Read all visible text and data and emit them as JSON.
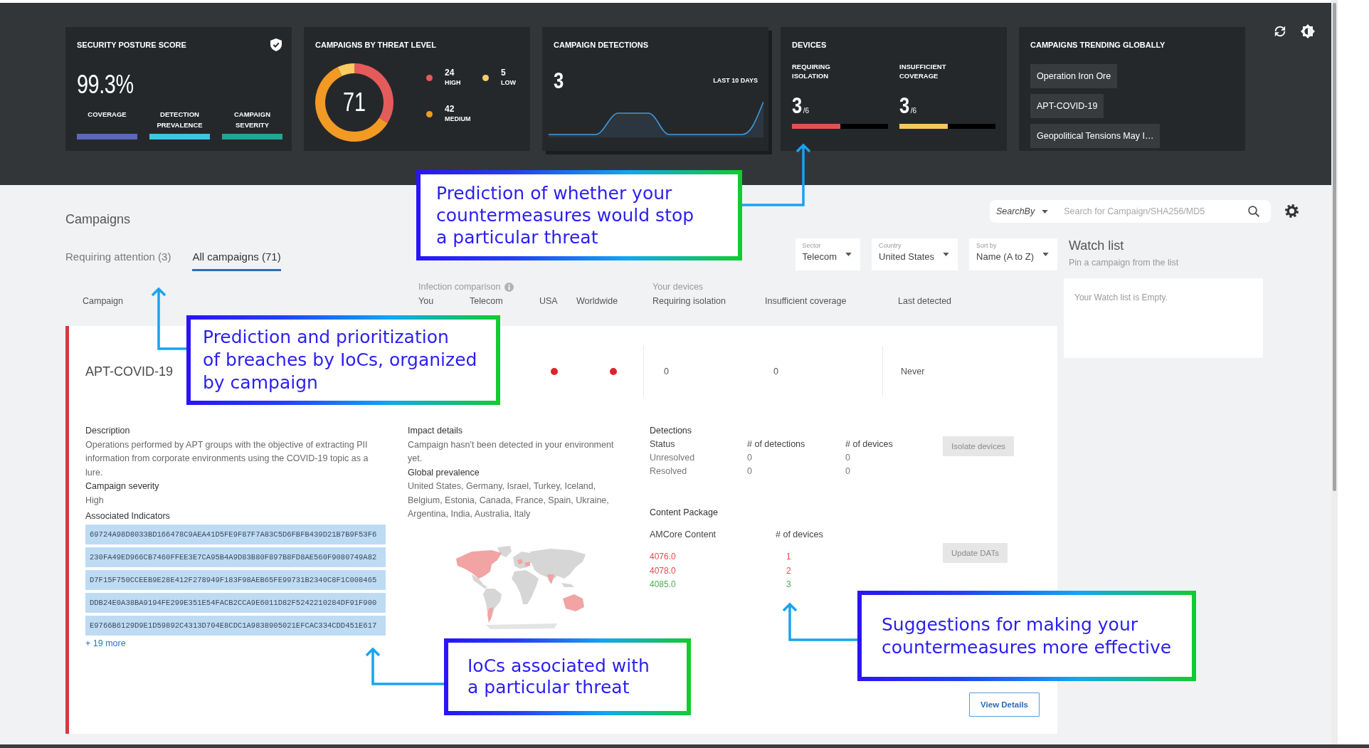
{
  "dashboard": {
    "security_posture": {
      "title": "SECURITY POSTURE SCORE",
      "score": "99.3%",
      "metrics": [
        {
          "label": "COVERAGE",
          "color": "#5c68b8"
        },
        {
          "label": "DETECTION PREVALENCE",
          "color": "#3ec6e2"
        },
        {
          "label": "CAMPAIGN SEVERITY",
          "color": "#22a595"
        }
      ]
    },
    "threat_levels": {
      "title": "CAMPAIGNS BY THREAT LEVEL",
      "total": "71",
      "legend": [
        {
          "count": "24",
          "label": "HIGH",
          "color": "#e55b5b"
        },
        {
          "count": "5",
          "label": "LOW",
          "color": "#f8cc62"
        },
        {
          "count": "42",
          "label": "MEDIUM",
          "color": "#f29a24"
        }
      ],
      "chart_data": {
        "type": "donut",
        "values": [
          33.8,
          7.04,
          59.16
        ]
      }
    },
    "campaign_detections": {
      "title": "CAMPAIGN DETECTIONS",
      "count": "3",
      "period": "LAST 10 DAYS"
    },
    "devices": {
      "title": "DEVICES",
      "metrics": [
        {
          "label": "REQUIRING ISOLATION",
          "value": "3",
          "total": "/6",
          "level": 0.5,
          "color": "#e05252"
        },
        {
          "label": "INSUFFICIENT COVERAGE",
          "value": "3",
          "total": "/6",
          "level": 0.5,
          "color": "#f6c85b"
        }
      ]
    },
    "trending": {
      "title": "CAMPAIGNS TRENDING GLOBALLY",
      "items": [
        "Operation Iron Ore",
        "APT-COVID-19",
        "Geopolitical Tensions May I…"
      ]
    }
  },
  "campaigns": {
    "title": "Campaigns",
    "search": {
      "search_by": "SearchBy",
      "placeholder": "Search for Campaign/SHA256/MD5"
    },
    "tabs": [
      {
        "label": "Requiring attention (3)",
        "selected": false
      },
      {
        "label": "All campaigns (71)",
        "selected": true
      }
    ],
    "filters": [
      {
        "label": "Sector",
        "value": "Telecom"
      },
      {
        "label": "Country",
        "value": "United States"
      },
      {
        "label": "Sort by",
        "value": "Name (A to Z)"
      }
    ],
    "table": {
      "columns": [
        {
          "kind": "column",
          "label": "Campaign"
        },
        {
          "kind": "group",
          "title": "Infection comparison",
          "info": true,
          "columns": [
            "You",
            "Telecom",
            "USA",
            "Worldwide"
          ]
        },
        {
          "kind": "group",
          "title": "Your devices",
          "columns": [
            "Requiring isolation",
            "Insufficient coverage"
          ]
        },
        {
          "kind": "column",
          "label": "Last detected"
        }
      ],
      "rows": [
        {
          "name": "APT-COVID-19",
          "color": "#d9383c",
          "infection": {
            "usa": true,
            "worldwide": true
          },
          "requiring_isolation": "0",
          "insufficient_coverage": "0",
          "last_detected": "Never",
          "expanded": true,
          "details": {
            "description": {
              "label": "Description",
              "text": "Operations performed by APT groups with the objective of extracting PII information from corporate environments using the COVID-19 topic as a lure."
            },
            "severity": {
              "label": "Campaign severity",
              "value": "High"
            },
            "indicators": {
              "label": "Associated Indicators",
              "hashes": [
                "69724A98D8033BD166478C9AEA41D5FE9F87F7A83C5D6FBFB439D21B7B9F53F6",
                "230FA49ED966CB7460FFEE3E7CA95B4A9D83B80F897B8FD8AE560F9080749A82",
                "D7F15F750CCEEB9E28E412F278949F183F98AEB65FE99731B2340C8F1C008465",
                "DDB24E0A38BA9194FE299E351E54FACB2CCA9E6011D82F5242210284DF91F900",
                "E9766B6129D9E1D59892C4313D704E8CDC1A9838905021EFCAC334CDD451E617"
              ],
              "more": "+ 19 more"
            },
            "impact": {
              "label": "Impact details",
              "text": "Campaign hasn't been detected in your environment yet."
            },
            "prevalence": {
              "label": "Global prevalence",
              "text": "United States, Germany, Israel, Turkey, Iceland, Belgium, Estonia, Canada, France, Spain, Ukraine, Argentina, India, Australia, Italy"
            },
            "detections": {
              "label": "Detections",
              "columns": [
                "Status",
                "# of detections",
                "# of devices"
              ],
              "rows": [
                [
                  "Unresolved",
                  "0",
                  "0"
                ],
                [
                  "Resolved",
                  "0",
                  "0"
                ]
              ],
              "action": {
                "label": "Isolate devices",
                "disabled": true
              }
            },
            "content_package": {
              "label": "Content Package",
              "columns": [
                "AMCore Content",
                "# of devices"
              ],
              "rows": [
                {
                  "version": "4076.0",
                  "devices": "1",
                  "color": "#e8474c"
                },
                {
                  "version": "4078.0",
                  "devices": "2",
                  "color": "#e8474c"
                },
                {
                  "version": "4085.0",
                  "devices": "3",
                  "color": "#4caf50"
                }
              ],
              "action": {
                "label": "Update DATs",
                "disabled": true
              }
            },
            "view_details": {
              "label": "View Details",
              "disabled": false
            }
          }
        }
      ]
    }
  },
  "watch_list": {
    "title": "Watch list",
    "subtitle": "Pin a campaign from the list",
    "empty_message": "Your Watch list is Empty."
  },
  "annotations": [
    {
      "text": "Prediction of whether your\ncountermeasures would stop\na particular threat"
    },
    {
      "text": "Prediction and prioritization\nof breaches by IoCs, organized\nby campaign"
    },
    {
      "text": "Suggestions for making your\ncountermeasures more effective"
    },
    {
      "text": "IoCs associated with\na particular threat"
    }
  ]
}
